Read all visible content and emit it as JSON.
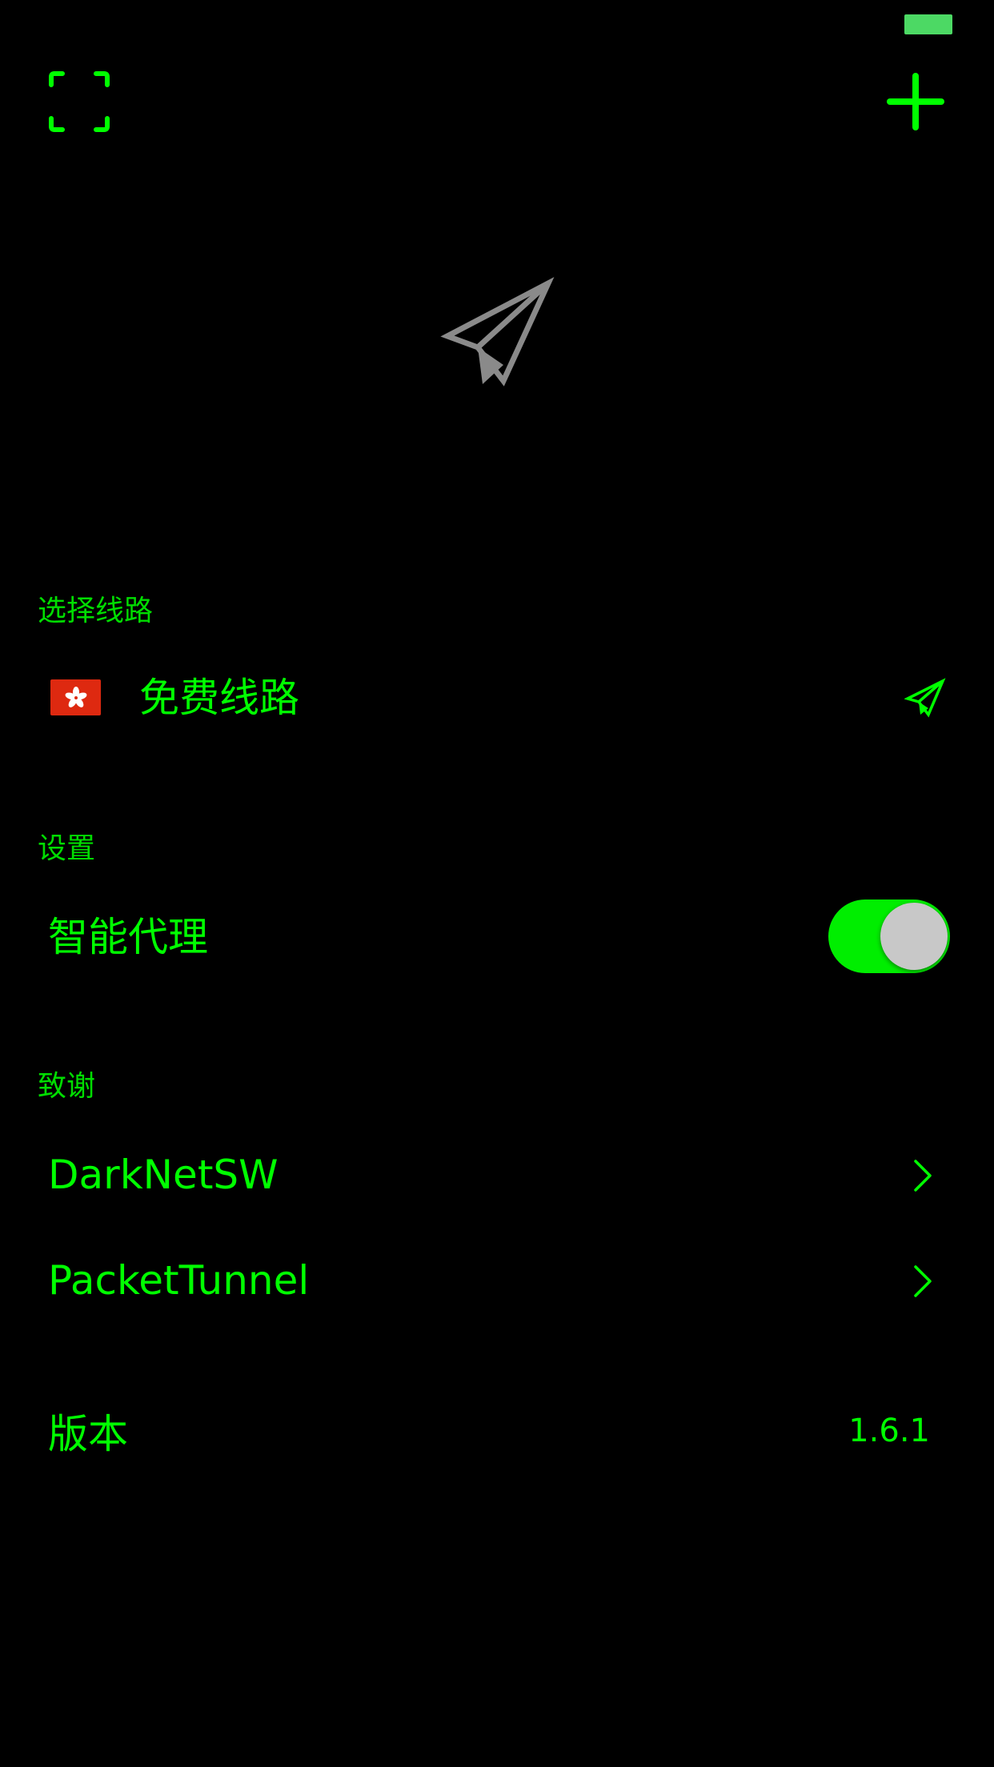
{
  "status_bar": {
    "battery_icon": "battery-icon"
  },
  "toolbar": {
    "scan_icon": "scan-frame-icon",
    "add_icon": "plus-icon"
  },
  "hero": {
    "icon": "paper-plane-icon"
  },
  "route_section": {
    "header": "选择线路",
    "item": {
      "flag_icon": "hong-kong-flag-icon",
      "name": "免费线路",
      "action_icon": "paper-plane-icon"
    }
  },
  "settings_section": {
    "header": "设置",
    "smart_proxy": {
      "label": "智能代理",
      "enabled": true
    }
  },
  "credits_section": {
    "header": "致谢",
    "items": [
      {
        "label": "DarkNetSW",
        "icon": "chevron-right-icon"
      },
      {
        "label": "PacketTunnel",
        "icon": "chevron-right-icon"
      }
    ]
  },
  "version": {
    "label": "版本",
    "value": "1.6.1"
  },
  "colors": {
    "background": "#000000",
    "accent": "#00ff00",
    "toggle_on": "#00ee00",
    "toggle_knob": "#c8c8c8",
    "hero_icon": "#8a8a8a",
    "flag_red": "#de2910",
    "battery": "#4cd964"
  }
}
